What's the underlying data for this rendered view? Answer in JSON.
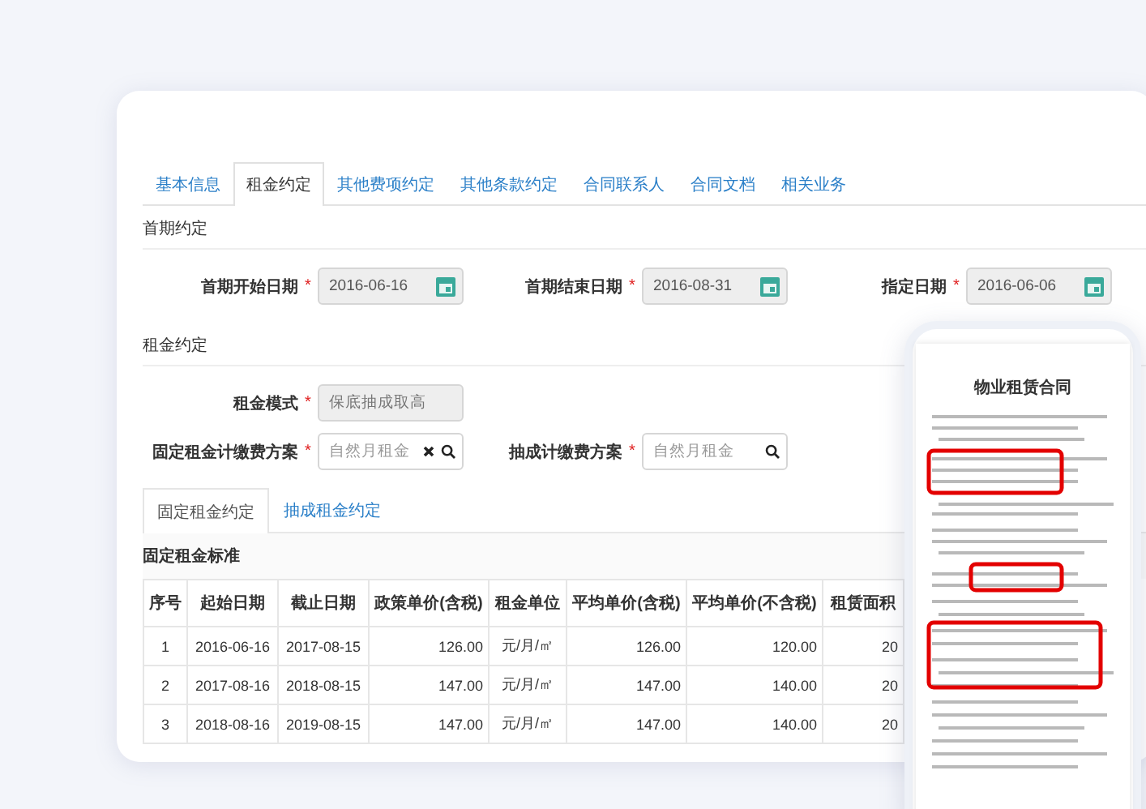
{
  "tabs": [
    {
      "label": "基本信息",
      "selected": false
    },
    {
      "label": "租金约定",
      "selected": true
    },
    {
      "label": "其他费项约定",
      "selected": false
    },
    {
      "label": "其他条款约定",
      "selected": false
    },
    {
      "label": "合同联系人",
      "selected": false
    },
    {
      "label": "合同文档",
      "selected": false
    },
    {
      "label": "相关业务",
      "selected": false
    }
  ],
  "first_period": {
    "title": "首期约定",
    "rows": [
      [
        {
          "label": "首期开始日期",
          "required_mark": "*",
          "kind": "date",
          "value": "2016-06-16"
        },
        {
          "label": "首期结束日期",
          "required_mark": "*",
          "kind": "date",
          "value": "2016-08-31"
        },
        {
          "label": "指定日期",
          "required_mark": "*",
          "kind": "date",
          "value": "2016-06-06"
        }
      ]
    ]
  },
  "rent": {
    "title": "租金约定",
    "rows": [
      [
        {
          "label": "租金模式",
          "required_mark": "*",
          "kind": "readonly",
          "value": "保底抽成取高"
        }
      ],
      [
        {
          "label": "固定租金计缴费方案",
          "required_mark": "*",
          "kind": "lookup",
          "clearable": true,
          "placeholder": "自然月租金"
        },
        {
          "label": "抽成计缴费方案",
          "required_mark": "*",
          "kind": "lookup",
          "clearable": false,
          "placeholder": "自然月租金"
        }
      ]
    ]
  },
  "sub_tabs": [
    {
      "label": "固定租金约定",
      "selected": true
    },
    {
      "label": "抽成租金约定",
      "selected": false
    }
  ],
  "table": {
    "title": "固定租金标准",
    "columns": [
      {
        "label": "序号",
        "numeric": false
      },
      {
        "label": "起始日期",
        "numeric": false
      },
      {
        "label": "截止日期",
        "numeric": false
      },
      {
        "label": "政策单价(含税)",
        "numeric": true
      },
      {
        "label": "租金单位",
        "numeric": false
      },
      {
        "label": "平均单价(含税)",
        "numeric": true
      },
      {
        "label": "平均单价(不含税)",
        "numeric": true
      },
      {
        "label": "租赁面积",
        "numeric": true
      }
    ],
    "rows": [
      [
        "1",
        "2016-06-16",
        "2017-08-15",
        "126.00",
        "元/月/㎡",
        "126.00",
        "120.00",
        "20"
      ],
      [
        "2",
        "2017-08-16",
        "2018-08-15",
        "147.00",
        "元/月/㎡",
        "147.00",
        "140.00",
        "20"
      ],
      [
        "3",
        "2018-08-16",
        "2019-08-15",
        "147.00",
        "元/月/㎡",
        "147.00",
        "140.00",
        "20"
      ]
    ]
  },
  "phone": {
    "document_title": "物业租赁合同"
  }
}
